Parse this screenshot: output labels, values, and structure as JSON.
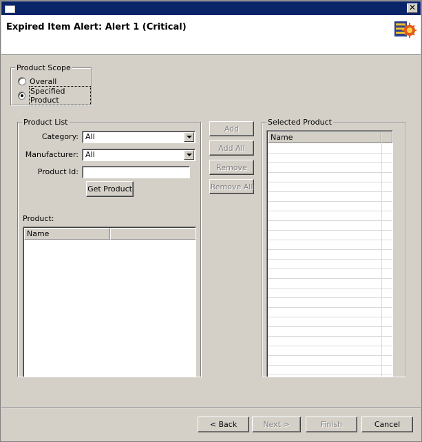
{
  "window": {
    "header_title": "Expired Item Alert: Alert 1  (Critical)",
    "close_glyph": "✕"
  },
  "product_scope": {
    "legend": "Product Scope",
    "options": [
      {
        "label": "Overall",
        "checked": false
      },
      {
        "label": "Specified Product",
        "checked": true
      }
    ]
  },
  "product_list": {
    "legend": "Product List",
    "category_label": "Category:",
    "category_value": "All",
    "manufacturer_label": "Manufacturer:",
    "manufacturer_value": "All",
    "product_id_label": "Product Id:",
    "product_id_value": "",
    "get_product_label": "Get Product",
    "product_label": "Product:",
    "columns": [
      "Name",
      ""
    ]
  },
  "actions": {
    "add_label": "Add",
    "add_all_label": "Add All",
    "remove_label": "Remove",
    "remove_all_label": "Remove All"
  },
  "selected_product": {
    "legend": "Selected Product",
    "columns": [
      "Name",
      ""
    ]
  },
  "footer": {
    "back_label": "< Back",
    "next_label": "Next >",
    "finish_label": "Finish",
    "cancel_label": "Cancel"
  },
  "colors": {
    "titlebar": "#0a246a",
    "face": "#d4d0c8"
  }
}
